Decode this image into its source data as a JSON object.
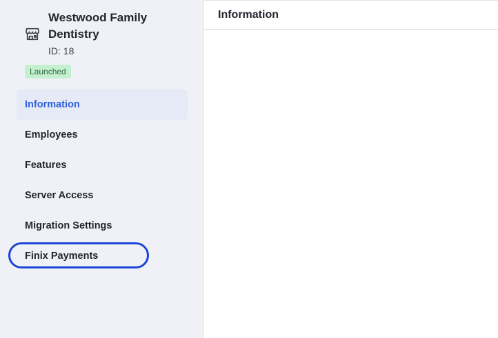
{
  "org": {
    "name": "Westwood Family Dentistry",
    "id_label": "ID: 18",
    "icon": "storefront-icon"
  },
  "status": {
    "label": "Launched",
    "color": "#c4f0cf"
  },
  "sidebar": {
    "items": [
      {
        "label": "Information",
        "active": true
      },
      {
        "label": "Employees",
        "active": false
      },
      {
        "label": "Features",
        "active": false
      },
      {
        "label": "Server Access",
        "active": false
      },
      {
        "label": "Migration Settings",
        "active": false
      },
      {
        "label": "Finix Payments",
        "active": false,
        "focused": true
      }
    ]
  },
  "main": {
    "title": "Information"
  },
  "colors": {
    "accent": "#2f5fd8",
    "focus_ring": "#1a44d6",
    "sidebar_bg": "#eff1f7"
  }
}
